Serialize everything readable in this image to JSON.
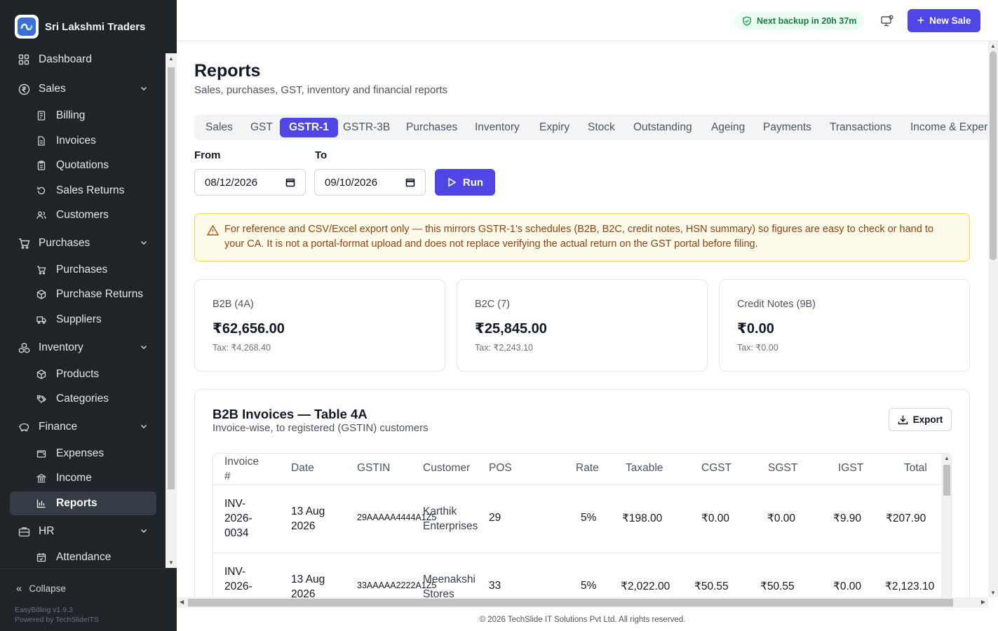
{
  "brand": {
    "name": "Sri Lakshmi Traders",
    "logo_icon": "infinity-logo-icon"
  },
  "nav": {
    "items": [
      {
        "label": "Dashboard",
        "icon": "grid-icon"
      },
      {
        "label": "Sales",
        "icon": "rupee-circle-icon",
        "expanded": true
      },
      {
        "label": "Billing",
        "icon": "receipt-icon"
      },
      {
        "label": "Invoices",
        "icon": "document-icon"
      },
      {
        "label": "Quotations",
        "icon": "clipboard-icon"
      },
      {
        "label": "Sales Returns",
        "icon": "rotate-icon"
      },
      {
        "label": "Customers",
        "icon": "users-icon"
      },
      {
        "label": "Purchases",
        "icon": "cart-icon",
        "expanded": true
      },
      {
        "label": "Purchases",
        "icon": "cart-icon"
      },
      {
        "label": "Purchase Returns",
        "icon": "package-return-icon"
      },
      {
        "label": "Suppliers",
        "icon": "truck-icon"
      },
      {
        "label": "Inventory",
        "icon": "boxes-icon",
        "expanded": true
      },
      {
        "label": "Products",
        "icon": "box-icon"
      },
      {
        "label": "Categories",
        "icon": "tags-icon"
      },
      {
        "label": "Finance",
        "icon": "piggy-bank-icon",
        "expanded": true
      },
      {
        "label": "Expenses",
        "icon": "wallet-icon"
      },
      {
        "label": "Income",
        "icon": "bank-icon"
      },
      {
        "label": "Reports",
        "icon": "bar-chart-icon",
        "active": true
      },
      {
        "label": "HR",
        "icon": "briefcase-icon",
        "expanded": true
      },
      {
        "label": "Attendance",
        "icon": "calendar-check-icon"
      }
    ],
    "collapse_label": "Collapse",
    "version": "EasyBilling v1.9.3",
    "powered_by": "Powered by TechSlideITS"
  },
  "topbar": {
    "backup_text": "Next backup in 20h 37m",
    "new_sale_label": "New Sale",
    "accent": "#4f46e5"
  },
  "page": {
    "title": "Reports",
    "subtitle": "Sales, purchases, GST, inventory and financial reports",
    "tabs": [
      "Sales",
      "GST",
      "GSTR-1",
      "GSTR-3B",
      "Purchases",
      "Inventory",
      "Expiry",
      "Stock",
      "Outstanding",
      "Ageing",
      "Payments",
      "Transactions",
      "Income & Exper"
    ],
    "active_tab": "GSTR-1",
    "from_label": "From",
    "from_value": "08/12/2026",
    "to_label": "To",
    "to_value": "09/10/2026",
    "run_label": "Run",
    "alert_text": "For reference and CSV/Excel export only — this mirrors GSTR-1's schedules (B2B, B2C, credit notes, HSN summary) so figures are easy to check or hand to your CA. It is not a portal-format upload and does not replace verifying the actual return on the GST portal before filing."
  },
  "summary_cards": [
    {
      "label": "B2B (4A)",
      "value": "₹62,656.00",
      "tax": "Tax: ₹4,268.40"
    },
    {
      "label": "B2C (7)",
      "value": "₹25,845.00",
      "tax": "Tax: ₹2,243.10"
    },
    {
      "label": "Credit Notes (9B)",
      "value": "₹0.00",
      "tax": "Tax: ₹0.00"
    }
  ],
  "b2b_table": {
    "title": "B2B Invoices — Table 4A",
    "subtitle": "Invoice-wise, to registered (GSTIN) customers",
    "export_label": "Export",
    "columns": [
      "Invoice #",
      "Date",
      "GSTIN",
      "Customer",
      "POS",
      "Rate",
      "Taxable",
      "CGST",
      "SGST",
      "IGST",
      "Total"
    ],
    "rows": [
      {
        "invoice": "INV-2026-0034",
        "date": "13 Aug 2026",
        "gstin": "29AAAAA4444A1Z5",
        "customer": "Karthik Enterprises",
        "pos": "29",
        "rate": "5%",
        "taxable": "₹198.00",
        "cgst": "₹0.00",
        "sgst": "₹0.00",
        "igst": "₹9.90",
        "total": "₹207.90"
      },
      {
        "invoice": "INV-2026-",
        "date": "13 Aug 2026",
        "gstin": "33AAAAA2222A1Z5",
        "customer": "Meenakshi Stores",
        "pos": "33",
        "rate": "5%",
        "taxable": "₹2,022.00",
        "cgst": "₹50.55",
        "sgst": "₹50.55",
        "igst": "₹0.00",
        "total": "₹2,123.10"
      }
    ]
  },
  "footer": "© 2026 TechSlide IT Solutions Pvt Ltd. All rights reserved."
}
